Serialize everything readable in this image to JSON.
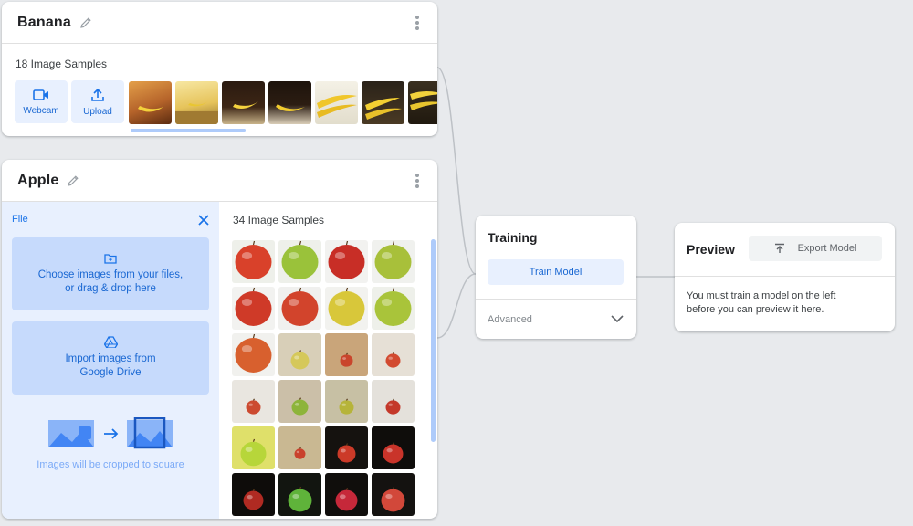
{
  "classes": [
    {
      "name": "Banana",
      "samples_label": "18 Image Samples",
      "webcam_label": "Webcam",
      "upload_label": "Upload"
    },
    {
      "name": "Apple",
      "samples_label": "34 Image Samples",
      "file_panel": {
        "title": "File",
        "choose_line1": "Choose images from your files,",
        "choose_line2": "or drag & drop here",
        "drive_line1": "Import images from",
        "drive_line2": "Google Drive",
        "crop_note": "Images will be cropped to square"
      }
    }
  ],
  "training": {
    "title": "Training",
    "train_button": "Train Model",
    "advanced_label": "Advanced"
  },
  "preview": {
    "title": "Preview",
    "export_button": "Export Model",
    "message_line1": "You must train a model on the left",
    "message_line2": "before you can preview it here."
  },
  "colors": {
    "accent": "#1a73e8",
    "accent_light": "#e8f0fe",
    "background": "#e8eaed"
  },
  "icons": [
    "pencil-icon",
    "kebab-menu-icon",
    "webcam-icon",
    "upload-icon",
    "close-icon",
    "folder-add-icon",
    "google-drive-icon",
    "crop-illustration",
    "chevron-down-icon",
    "export-icon"
  ]
}
